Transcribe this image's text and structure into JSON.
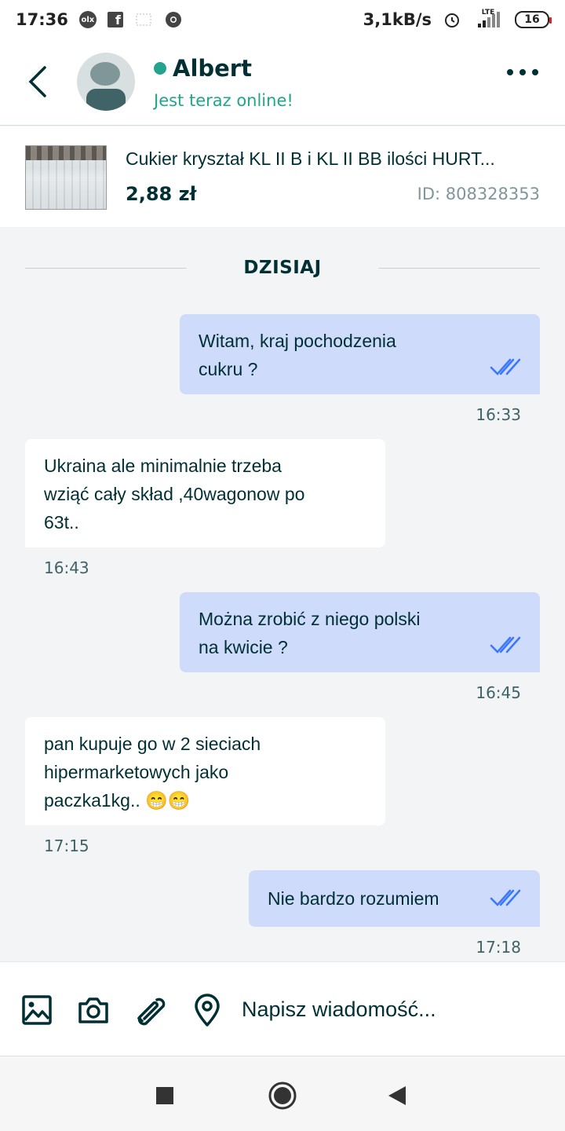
{
  "status_bar": {
    "time": "17:36",
    "speed": "3,1kB/s",
    "network": "LTE",
    "battery": "16",
    "icons": [
      "olx-icon",
      "facebook-icon",
      "placeholder-icon",
      "chrome-icon",
      "alarm-icon",
      "signal-icon",
      "battery-icon"
    ]
  },
  "header": {
    "user_name": "Albert",
    "status": "Jest teraz online!",
    "online_color": "#23a58d"
  },
  "ad": {
    "title": "Cukier kryształ KL II B i KL II BB  ilości HURT...",
    "price": "2,88 zł",
    "id": "ID: 808328353"
  },
  "chat": {
    "day_label": "DZISIAJ",
    "messages": [
      {
        "direction": "out",
        "lines": [
          "Witam, kraj pochodzenia",
          "cukru ?"
        ],
        "time": "16:33",
        "read": true
      },
      {
        "direction": "in",
        "lines": [
          "Ukraina ale minimalnie trzeba",
          "wziąć cały skład ,40wagonow po",
          "63t.."
        ],
        "time": "16:43"
      },
      {
        "direction": "out",
        "lines": [
          "Można zrobić z niego polski",
          "na kwicie ?"
        ],
        "time": "16:45",
        "read": true
      },
      {
        "direction": "in",
        "lines": [
          "pan kupuje go w 2 sieciach",
          "hipermarketowych jako",
          "paczka1kg.. 😁😁"
        ],
        "time": "17:15"
      },
      {
        "direction": "out",
        "lines": [
          "Nie bardzo rozumiem"
        ],
        "time": "17:18",
        "read": true
      }
    ]
  },
  "composer": {
    "placeholder": "Napisz wiadomość...",
    "icons": [
      "image-icon",
      "camera-icon",
      "attachment-icon",
      "location-icon"
    ]
  },
  "nav": {
    "icons": [
      "recents-icon",
      "home-icon",
      "back-icon"
    ]
  },
  "colors": {
    "outgoing_bubble": "#cedbfb",
    "incoming_bubble": "#ffffff",
    "tick": "#3a77ff",
    "text": "#002f34"
  }
}
